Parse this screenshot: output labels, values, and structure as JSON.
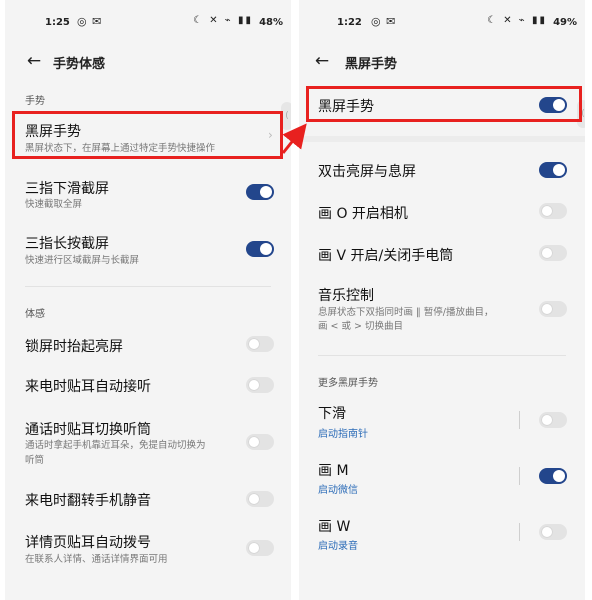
{
  "left": {
    "status": {
      "time": "1:25",
      "left_icons": "◎ ✉",
      "right_icons": "☾ ✕ ⌁ ▮▮",
      "battery": "48%"
    },
    "title": "手势体感",
    "gesture_section": "手势",
    "black_screen": {
      "title": "黑屏手势",
      "subtitle": "黑屏状态下，在屏幕上通过特定手势快捷操作"
    },
    "three_swipe": {
      "title": "三指下滑截屏",
      "subtitle": "快速截取全屏"
    },
    "three_press": {
      "title": "三指长按截屏",
      "subtitle": "快速进行区域截屏与长截屏"
    },
    "motion_section": "体感",
    "raise_wake": {
      "title": "锁屏时抬起亮屏"
    },
    "ear_answer": {
      "title": "来电时贴耳自动接听"
    },
    "ear_switch": {
      "title": "通话时贴耳切换听筒",
      "subtitle_1": "通话时拿起手机靠近耳朵，免提自动切换为",
      "subtitle_2": "听筒"
    },
    "flip_mute": {
      "title": "来电时翻转手机静音"
    },
    "ear_dial": {
      "title": "详情页贴耳自动拨号",
      "subtitle": "在联系人详情、通话详情界面可用"
    }
  },
  "right": {
    "status": {
      "time": "1:22",
      "left_icons": "◎ ✉",
      "right_icons": "☾ ✕ ⌁ ▮▮",
      "battery": "49%"
    },
    "title": "黑屏手势",
    "master": {
      "title": "黑屏手势"
    },
    "double_tap": {
      "title": "双击亮屏与息屏"
    },
    "draw_o": {
      "title": "画 O 开启相机"
    },
    "draw_v": {
      "title": "画 V 开启/关闭手电筒"
    },
    "music": {
      "title": "音乐控制",
      "subtitle_1": "息屏状态下双指同时画 ‖ 暂停/播放曲目，",
      "subtitle_2": "画 < 或 > 切换曲目"
    },
    "more_section": "更多黑屏手势",
    "swipe_down": {
      "title": "下滑",
      "action": "启动指南针"
    },
    "draw_m": {
      "title": "画 M",
      "action": "启动微信"
    },
    "draw_w": {
      "title": "画 W",
      "action": "启动录音"
    }
  },
  "toggles": {
    "three_swipe": true,
    "three_press": true,
    "raise_wake": false,
    "ear_answer": false,
    "ear_switch": false,
    "flip_mute": false,
    "ear_dial": false,
    "master": true,
    "double_tap": true,
    "draw_o": false,
    "draw_v": false,
    "music": false,
    "swipe_down": false,
    "draw_m": true,
    "draw_w": false
  },
  "colors": {
    "accent": "#23468c",
    "highlight": "#e8211f",
    "link": "#2b6bb7",
    "background": "#f4f4f4"
  },
  "icons": {
    "back": "arrow-left-icon",
    "chevron": "chevron-right-icon"
  }
}
